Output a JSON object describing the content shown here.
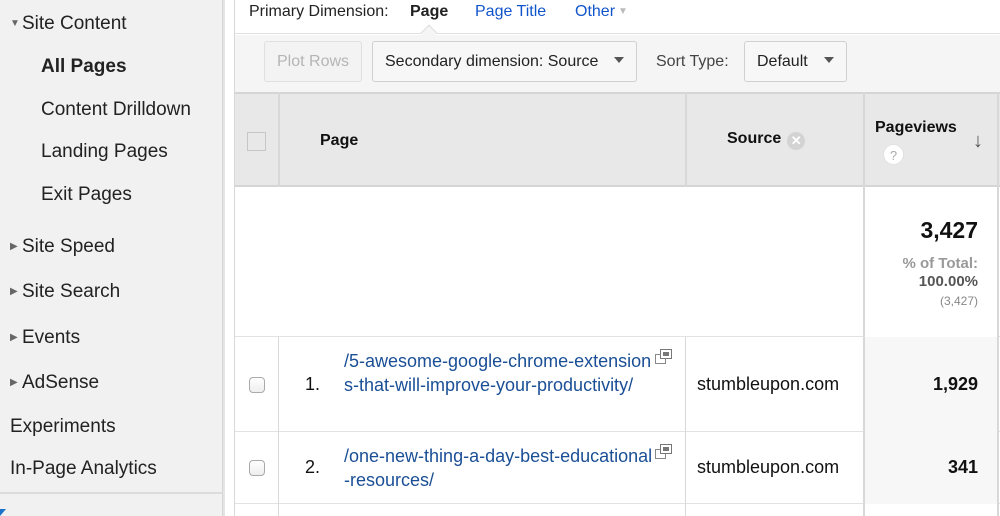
{
  "sidebar": {
    "section": {
      "label": "Site Content",
      "expanded": true
    },
    "subitems": [
      {
        "label": "All Pages",
        "active": true
      },
      {
        "label": "Content Drilldown",
        "active": false
      },
      {
        "label": "Landing Pages",
        "active": false
      },
      {
        "label": "Exit Pages",
        "active": false
      }
    ],
    "collapsed_sections": [
      {
        "label": "Site Speed"
      },
      {
        "label": "Site Search"
      },
      {
        "label": "Events"
      },
      {
        "label": "AdSense"
      }
    ],
    "top_items": [
      {
        "label": "Experiments"
      },
      {
        "label": "In-Page Analytics"
      }
    ]
  },
  "dimension_bar": {
    "label": "Primary Dimension:",
    "selected": "Page",
    "options": [
      "Page Title",
      "Other"
    ]
  },
  "toolbar": {
    "plot_rows_label": "Plot Rows",
    "secondary_dimension_label": "Secondary dimension: Source",
    "sort_type_label": "Sort Type:",
    "sort_type_value": "Default"
  },
  "table": {
    "columns": {
      "page": "Page",
      "source": "Source",
      "pageviews": "Pageviews"
    },
    "icons": {
      "remove": "✕",
      "help": "?",
      "sort": "↓",
      "expand_caret": "▼",
      "collapsed_caret": "▶"
    },
    "totals": {
      "value": "3,427",
      "pct_label": "% of Total:",
      "pct_value": "100.00%",
      "abs_value": "(3,427)"
    },
    "rows": [
      {
        "num": "1.",
        "page": "/5-awesome-google-chrome-extensions-that-will-improve-your-productivity/",
        "source": "stumbleupon.com",
        "pageviews": "1,929"
      },
      {
        "num": "2.",
        "page": "/one-new-thing-a-day-best-educational-resources/",
        "source": "stumbleupon.com",
        "pageviews": "341"
      }
    ]
  }
}
